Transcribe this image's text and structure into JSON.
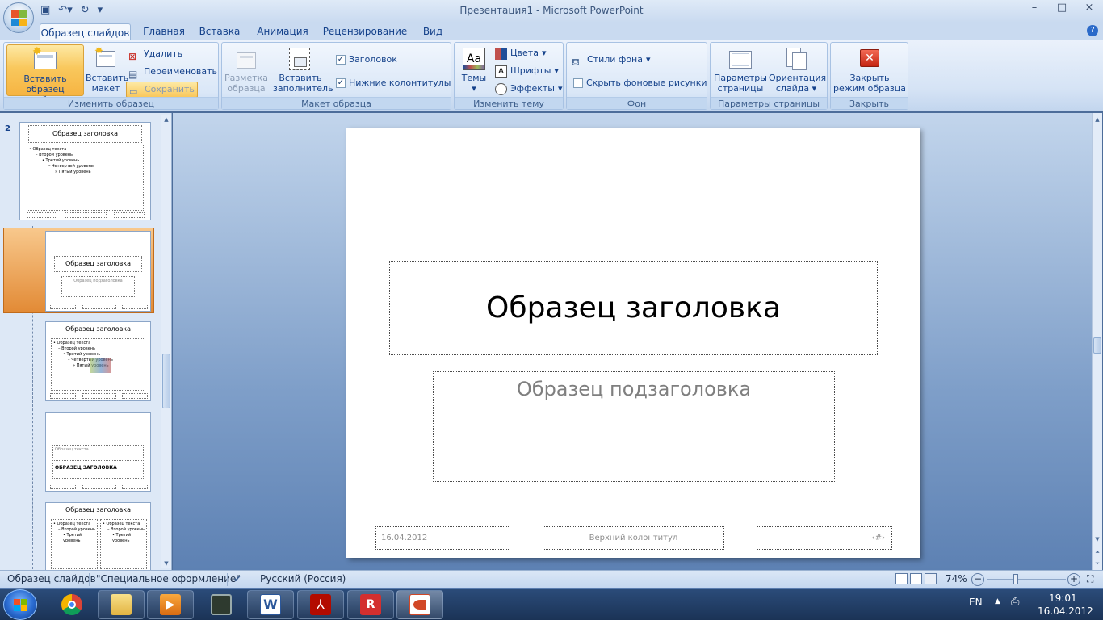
{
  "window": {
    "title": "Презентация1 - Microsoft PowerPoint",
    "controls": [
      "–",
      "□",
      "×"
    ]
  },
  "qat": {
    "icons": [
      "save-icon",
      "undo-icon",
      "redo-icon",
      "customize-qat-icon"
    ]
  },
  "tabs": [
    {
      "label": "Образец слайдов",
      "active": true
    },
    {
      "label": "Главная"
    },
    {
      "label": "Вставка"
    },
    {
      "label": "Анимация"
    },
    {
      "label": "Рецензирование"
    },
    {
      "label": "Вид"
    }
  ],
  "ribbon": {
    "edit_master": {
      "label": "Изменить образец",
      "insert_master": "Вставить образец слайдов",
      "insert_layout": "Вставить макет",
      "delete": "Удалить",
      "rename": "Переименовать",
      "save": "Сохранить"
    },
    "master_layout": {
      "label": "Макет образца",
      "layout": "Разметка образца",
      "insert_placeholder": "Вставить заполнитель",
      "title_check": "Заголовок",
      "footers_check": "Нижние колонтитулы"
    },
    "edit_theme": {
      "label": "Изменить тему",
      "themes": "Темы",
      "colors": "Цвета",
      "fonts": "Шрифты",
      "effects": "Эффекты"
    },
    "background": {
      "label": "Фон",
      "styles": "Стили фона",
      "hide_graphics": "Скрыть фоновые рисунки"
    },
    "page_setup": {
      "label": "Параметры страницы",
      "page_setup": "Параметры страницы",
      "orientation": "Ориентация слайда"
    },
    "close": {
      "label": "Закрыть",
      "close_master": "Закрыть режим образца"
    }
  },
  "thumbnails": {
    "slide_number": "2",
    "items": [
      {
        "title": "Образец заголовка",
        "body": [
          "• Образец текста",
          "– Второй уровень",
          "• Третий уровень",
          "– Четвертый уровень",
          "» Пятый уровень"
        ]
      },
      {
        "title": "Образец заголовка",
        "subtitle": "Образец подзаголовка"
      },
      {
        "title": "Образец заголовка",
        "body": [
          "• Образец текста",
          "– Второй уровень",
          "• Третий уровень",
          "– Четвертый уровень",
          "» Пятый уровень"
        ]
      },
      {
        "text": "Образец текста",
        "title": "ОБРАЗЕЦ ЗАГОЛОВКА"
      },
      {
        "title": "Образец заголовка",
        "body": [
          "• Образец текста",
          "– Второй уровень",
          "• Третий уровень"
        ]
      }
    ]
  },
  "slide": {
    "title": "Образец заголовка",
    "subtitle": "Образец подзаголовка",
    "date": "16.04.2012",
    "footer": "Верхний колонтитул",
    "slide_number": "‹#›"
  },
  "status": {
    "mode": "Образец слайдов",
    "theme": "\"Специальное оформление\"",
    "language": "Русский (Россия)",
    "zoom": "74%",
    "zoom_level": 0.74
  },
  "taskbar": {
    "apps": [
      "chrome-icon",
      "explorer-icon",
      "media-player-icon",
      "monitor-icon",
      "word-icon",
      "acrobat-icon",
      "flashrecord-icon",
      "powerpoint-icon"
    ]
  },
  "tray": {
    "lang": "EN",
    "time": "19:01",
    "date": "16.04.2012"
  },
  "colors": {
    "ribbon_bg": "#d5e3f5",
    "accent_orange": "#f6b442",
    "canvas_bg": "#7f9fc9",
    "taskbar": "#1b3356"
  }
}
